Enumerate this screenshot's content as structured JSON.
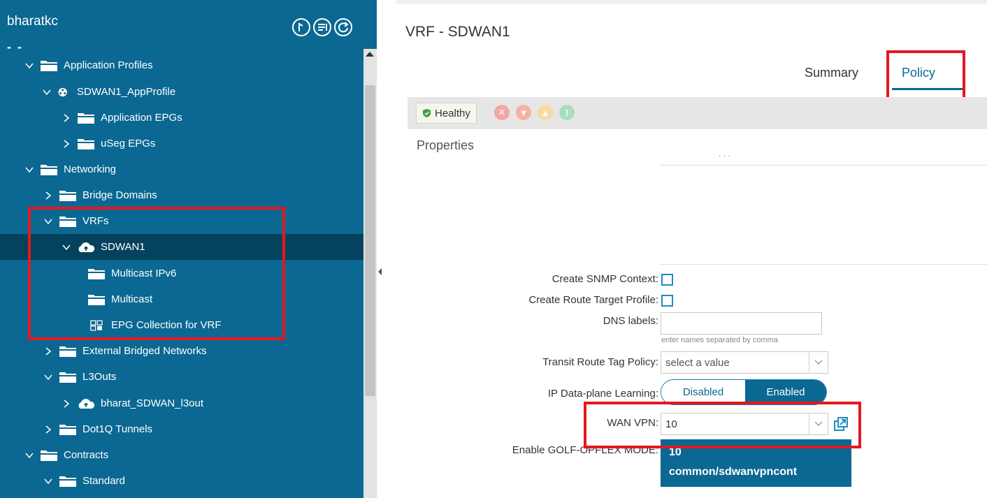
{
  "nav": {
    "tenant_name": "bharatkc",
    "tenant_subtitle": "- -",
    "header_icons": [
      "quick-start-icon",
      "filter-list-icon",
      "refresh-icon"
    ],
    "tree": [
      {
        "label": "Application Profiles",
        "expanded": true,
        "icon": "folder-icon"
      },
      {
        "label": "SDWAN1_AppProfile",
        "expanded": true,
        "icon": "app-profile-icon"
      },
      {
        "label": "Application EPGs",
        "expanded": false,
        "icon": "folder-icon"
      },
      {
        "label": "uSeg EPGs",
        "expanded": false,
        "icon": "folder-icon"
      },
      {
        "label": "Networking",
        "expanded": true,
        "icon": "folder-icon"
      },
      {
        "label": "Bridge Domains",
        "expanded": false,
        "icon": "folder-icon"
      },
      {
        "label": "VRFs",
        "expanded": true,
        "icon": "folder-icon"
      },
      {
        "label": "SDWAN1",
        "expanded": true,
        "icon": "vrf-cloud-icon",
        "selected": true
      },
      {
        "label": "Multicast IPv6",
        "icon": "folder-icon"
      },
      {
        "label": "Multicast",
        "icon": "folder-icon"
      },
      {
        "label": "EPG Collection for VRF",
        "icon": "epg-collection-icon"
      },
      {
        "label": "External Bridged Networks",
        "expanded": false,
        "icon": "folder-icon"
      },
      {
        "label": "L3Outs",
        "expanded": true,
        "icon": "folder-icon"
      },
      {
        "label": "bharat_SDWAN_l3out",
        "expanded": false,
        "icon": "l3out-cloud-icon"
      },
      {
        "label": "Dot1Q Tunnels",
        "expanded": false,
        "icon": "folder-icon"
      },
      {
        "label": "Contracts",
        "expanded": true,
        "icon": "folder-icon"
      },
      {
        "label": "Standard",
        "expanded": true,
        "icon": "folder-icon"
      }
    ]
  },
  "content": {
    "title": "VRF - SDWAN1",
    "tabs": [
      {
        "label": "Summary",
        "active": false
      },
      {
        "label": "Policy",
        "active": true
      }
    ],
    "health_label": "Healthy",
    "fault_icons": [
      "critical-fault-icon",
      "major-fault-icon",
      "minor-fault-icon",
      "warning-fault-icon"
    ],
    "properties_label": "Properties",
    "faint_marks": ". . .",
    "fields": {
      "snmp_context": {
        "label": "Create SNMP Context:",
        "checked": false
      },
      "route_target": {
        "label": "Create Route Target Profile:",
        "checked": false
      },
      "dns_labels": {
        "label": "DNS labels:",
        "value": "",
        "hint": "enter names separated by comma"
      },
      "transit_route": {
        "label": "Transit Route Tag Policy:",
        "placeholder": "select a value"
      },
      "ip_learning": {
        "label": "IP Data-plane Learning:",
        "options": [
          "Disabled",
          "Enabled"
        ],
        "selected": "Enabled"
      },
      "wan_vpn": {
        "label": "WAN VPN:",
        "value": "10"
      },
      "golf_opflex": {
        "label": "Enable GOLF-OPFLEX MODE:"
      }
    },
    "wan_vpn_options": [
      "10",
      "common/sdwanvpncont"
    ]
  },
  "colors": {
    "nav_bg": "#0b6892",
    "nav_selected": "#04425d",
    "accent": "#0b6892",
    "highlight_box": "#e5171f",
    "healthy_green": "#3e9b3a"
  }
}
